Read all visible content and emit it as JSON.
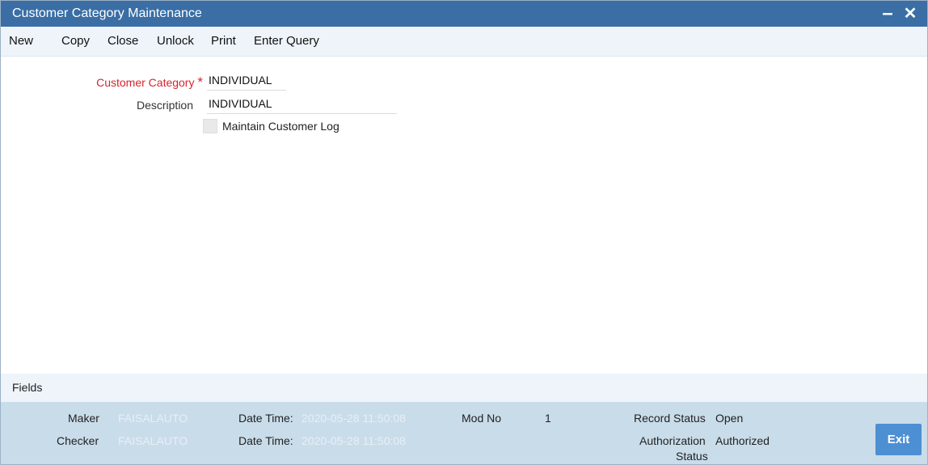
{
  "window": {
    "title": "Customer Category Maintenance",
    "minimize_glyph": "–",
    "close_glyph": "✕"
  },
  "toolbar": {
    "items": [
      "New",
      "Copy",
      "Close",
      "Unlock",
      "Print",
      "Enter Query"
    ]
  },
  "form": {
    "customer_category_label": "Customer Category",
    "required_marker": "*",
    "customer_category_value": "INDIVIDUAL",
    "description_label": "Description",
    "description_value": "INDIVIDUAL",
    "maintain_log_label": "Maintain Customer Log",
    "maintain_log_checked": false
  },
  "footer": {
    "fields_label": "Fields",
    "maker_label": "Maker",
    "maker_value": "FAISALAUTO",
    "checker_label": "Checker",
    "checker_value": "FAISALAUTO",
    "maker_datetime_label": "Date Time:",
    "maker_datetime_value": "2020-05-28 11:50:08",
    "checker_datetime_label": "Date Time:",
    "checker_datetime_value": "2020-05-28 11:50:08",
    "mod_no_label": "Mod No",
    "mod_no_value": "1",
    "record_status_label": "Record Status",
    "record_status_value": "Open",
    "auth_status_label_line1": "Authorization",
    "auth_status_label_line2": "Status",
    "auth_status_value": "Authorized",
    "exit_label": "Exit"
  },
  "colors": {
    "titlebar": "#3a6ea5",
    "toolbar_bg": "#eef4fa",
    "audit_bg": "#c9dcea",
    "exit_button": "#4d8fd3",
    "required_label": "#d9232d"
  }
}
